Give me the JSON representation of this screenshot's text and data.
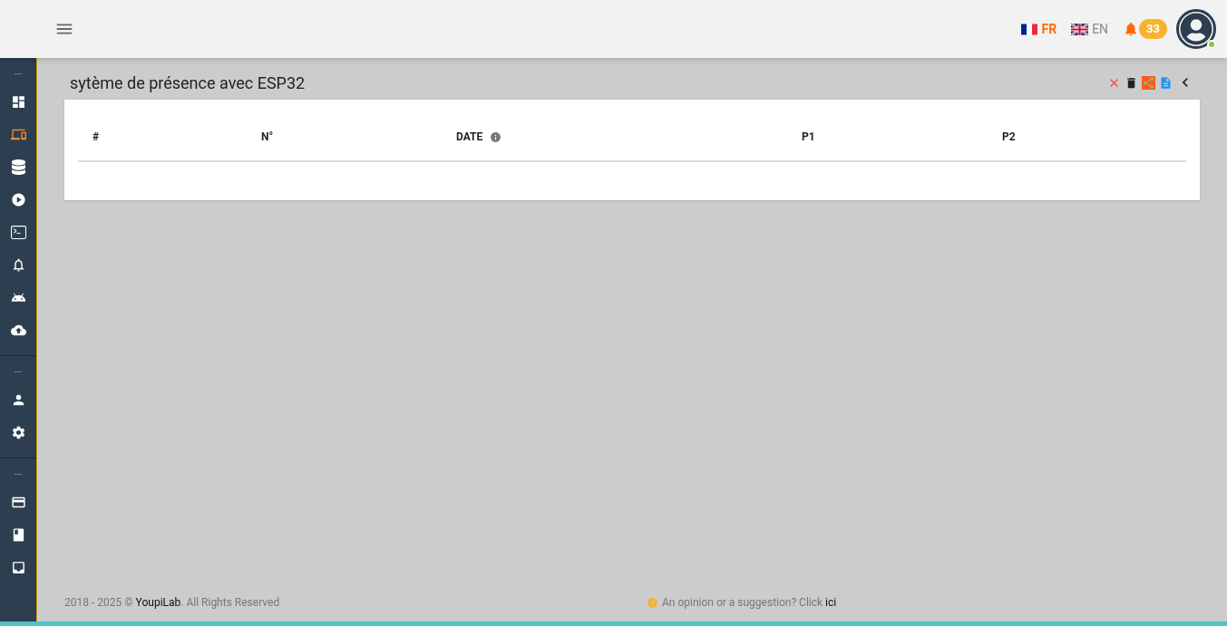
{
  "header": {
    "languages": [
      {
        "code": "FR",
        "selected": true
      },
      {
        "code": "EN",
        "selected": false
      }
    ],
    "notifications": {
      "count": "33"
    },
    "user": {
      "online": true
    }
  },
  "sidebar": {
    "sections": [
      {
        "label": "---",
        "items": [
          {
            "selected": false
          },
          {
            "selected": true
          },
          {
            "selected": false
          },
          {
            "selected": false
          },
          {
            "selected": false
          },
          {
            "selected": false
          },
          {
            "selected": false
          },
          {
            "selected": false
          }
        ]
      },
      {
        "label": "---",
        "items": [
          {
            "selected": false
          },
          {
            "selected": false
          }
        ]
      },
      {
        "label": "---",
        "items": [
          {
            "selected": false
          },
          {
            "selected": false
          },
          {
            "selected": false
          }
        ]
      }
    ]
  },
  "page": {
    "title": "sytème de présence avec ESP32"
  },
  "table": {
    "columns": [
      "#",
      "N°",
      "DATE",
      "P1",
      "P2"
    ]
  },
  "footer": {
    "copyright_prefix": "2018 - 2025 © ",
    "company": "YoupiLab",
    "copyright_suffix": ". All Rights Reserved",
    "suggestion": "An opinion or a suggestion? Click ",
    "suggestion_link": "ici"
  }
}
